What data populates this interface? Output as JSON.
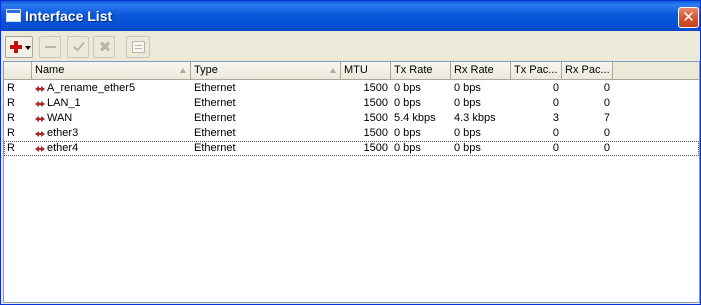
{
  "window": {
    "title": "Interface List",
    "close_glyph": "✕"
  },
  "toolbar": {
    "buttons": [
      {
        "name": "add-button",
        "icon": "plus-icon",
        "enabled": true
      },
      {
        "name": "remove-button",
        "icon": "minus-icon",
        "enabled": false
      },
      {
        "name": "enable-button",
        "icon": "check-icon",
        "enabled": false
      },
      {
        "name": "disable-button",
        "icon": "x-icon",
        "enabled": false
      },
      {
        "name": "comment-button",
        "icon": "note-icon",
        "enabled": false
      }
    ],
    "x_glyph": "✖"
  },
  "table": {
    "columns": [
      "",
      "Name",
      "Type",
      "MTU",
      "Tx Rate",
      "Rx Rate",
      "Tx Pac...",
      "Rx Pac..."
    ],
    "rows": [
      {
        "flag": "R",
        "name": "A_rename_ether5",
        "type": "Ethernet",
        "mtu": "1500",
        "tx_rate": "0 bps",
        "rx_rate": "0 bps",
        "tx_packets": "0",
        "rx_packets": "0"
      },
      {
        "flag": "R",
        "name": "LAN_1",
        "type": "Ethernet",
        "mtu": "1500",
        "tx_rate": "0 bps",
        "rx_rate": "0 bps",
        "tx_packets": "0",
        "rx_packets": "0"
      },
      {
        "flag": "R",
        "name": "WAN",
        "type": "Ethernet",
        "mtu": "1500",
        "tx_rate": "5.4 kbps",
        "rx_rate": "4.3 kbps",
        "tx_packets": "3",
        "rx_packets": "7"
      },
      {
        "flag": "R",
        "name": "ether3",
        "type": "Ethernet",
        "mtu": "1500",
        "tx_rate": "0 bps",
        "rx_rate": "0 bps",
        "tx_packets": "0",
        "rx_packets": "0"
      },
      {
        "flag": "R",
        "name": "ether4",
        "type": "Ethernet",
        "mtu": "1500",
        "tx_rate": "0 bps",
        "rx_rate": "0 bps",
        "tx_packets": "0",
        "rx_packets": "0"
      }
    ],
    "focused_row": 4
  },
  "colors": {
    "titlebar": "#0a58dd",
    "close": "#d65a3a",
    "add_icon": "#c81010",
    "interface_icon": "#a52a2a"
  }
}
